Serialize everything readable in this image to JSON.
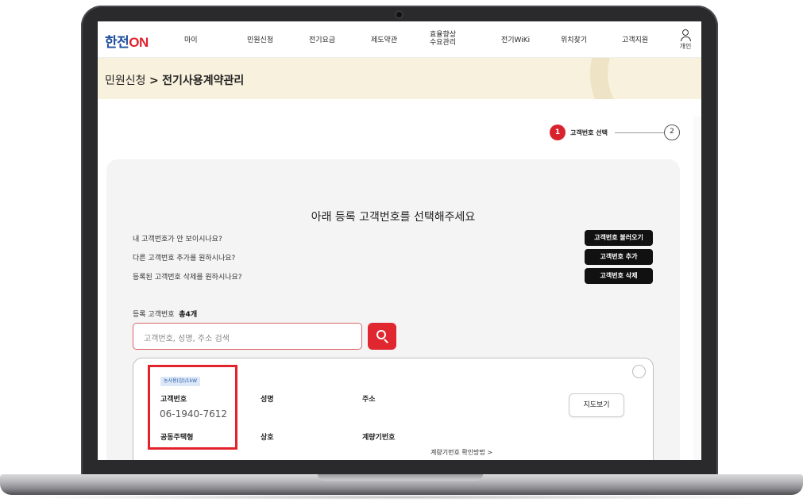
{
  "nav": {
    "logo_part1": "한전",
    "logo_part2": "ON",
    "items": [
      "마이",
      "민원신청",
      "전기요금",
      "제도약관",
      "효율향상\n수요관리",
      "전기WiKi",
      "위치찾기",
      "고객지원"
    ],
    "user_label": "개인"
  },
  "breadcrumb": {
    "parent": "민원신청",
    "separator": ">",
    "current": "전기사용계약관리"
  },
  "stepper": {
    "step1_num": "1",
    "step1_label": "고객번호 선택",
    "step2_num": "2"
  },
  "panel": {
    "title": "아래 등록 고객번호를 선택해주세요",
    "questions": [
      {
        "text": "내 고객번호가 안 보이시나요?",
        "button": "고객번호 불러오기"
      },
      {
        "text": "다른 고객번호 추가를 원하시나요?",
        "button": "고객번호 추가"
      },
      {
        "text": "등록된 고객번호 삭제를 원하시나요?",
        "button": "고객번호 삭제"
      }
    ],
    "registered_label": "등록 고객번호",
    "registered_count": "총4개",
    "search_placeholder": "고객번호, 성명, 주소 검색"
  },
  "card": {
    "badge": "농사용(갑)/1kW",
    "customer_no_label": "고객번호",
    "customer_no": "06-1940-7612",
    "name_label": "성명",
    "address_label": "주소",
    "housing_label": "공동주택형",
    "trade_label": "상호",
    "meter_label": "계량기번호",
    "map_button": "지도보기",
    "meter_link": "계량기번호 확인방법 >"
  },
  "colors": {
    "accent": "#e0262f",
    "brand_blue": "#1d4e9e",
    "band": "#f8f1dd"
  }
}
